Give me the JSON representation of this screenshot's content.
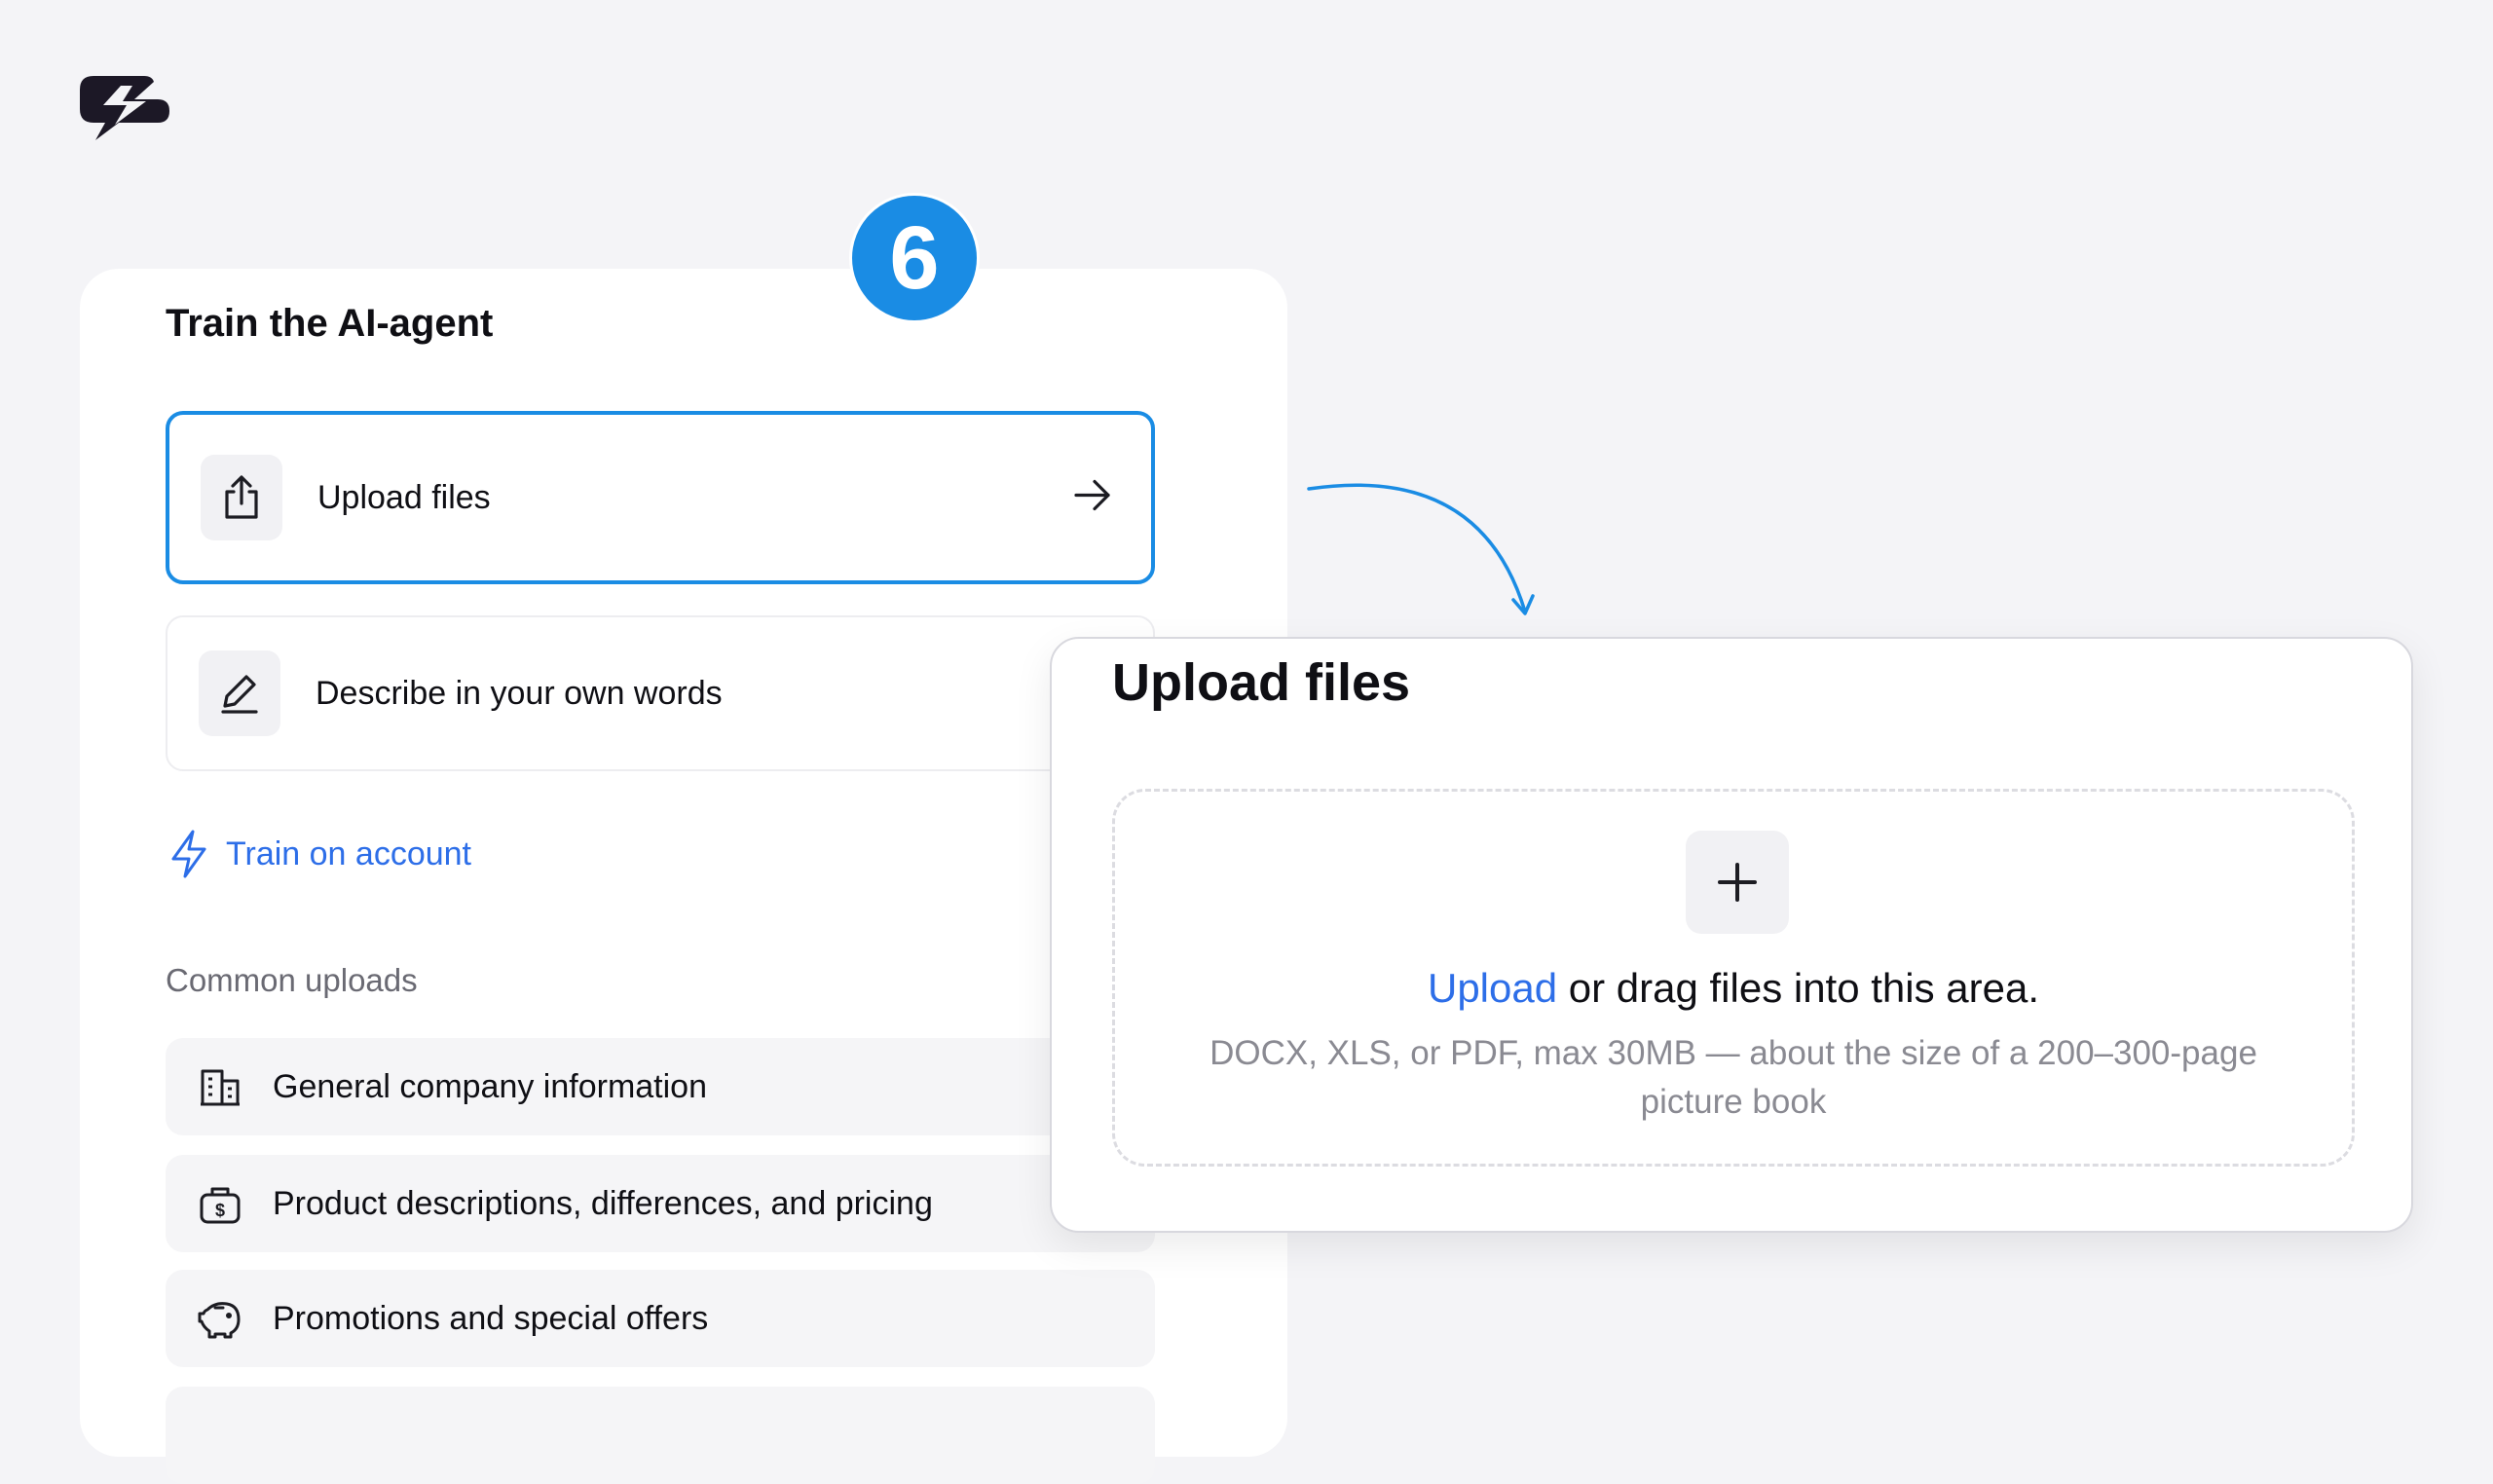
{
  "brand": {
    "logo_icon": "brand-logo-icon"
  },
  "step": {
    "number": "6"
  },
  "train_card": {
    "title": "Train the AI-agent",
    "options": [
      {
        "label": "Upload files",
        "icon": "upload-icon",
        "selected": true
      },
      {
        "label": "Describe in your own words",
        "icon": "pen-icon",
        "selected": false
      }
    ],
    "train_link": {
      "label": "Train on account",
      "icon": "lightning-icon"
    },
    "common_uploads": {
      "title": "Common uploads",
      "items": [
        {
          "label": "General company information",
          "icon": "building-icon"
        },
        {
          "label": "Product descriptions, differences, and pricing",
          "icon": "price-bag-icon"
        },
        {
          "label": "Promotions and special offers",
          "icon": "piggy-bank-icon"
        }
      ]
    }
  },
  "upload_dialog": {
    "title": "Upload files",
    "upload_link": "Upload",
    "drag_text": " or drag files into this area.",
    "hint": "DOCX, XLS, or PDF, max 30MB — about the size of a 200–300-page picture book"
  },
  "colors": {
    "accent": "#1a8ce4",
    "link": "#2d6ee8",
    "background": "#f4f4f7"
  }
}
